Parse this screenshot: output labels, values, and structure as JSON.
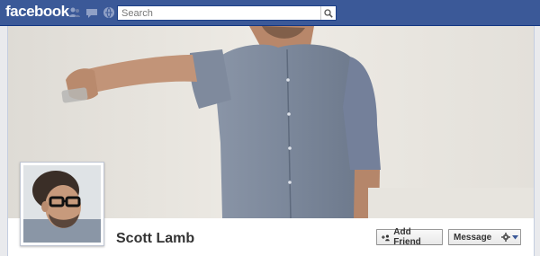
{
  "header": {
    "logo_text": "facebook",
    "brand_color": "#3b5998",
    "icons": [
      "friend-requests-icon",
      "messages-icon",
      "notifications-icon"
    ],
    "search": {
      "placeholder": "Search",
      "value": ""
    }
  },
  "profile": {
    "name": "Scott Lamb",
    "add_friend_label": "Add Friend",
    "message_label": "Message",
    "settings_icon": "gear-icon",
    "dropdown_icon": "chevron-down-icon"
  }
}
